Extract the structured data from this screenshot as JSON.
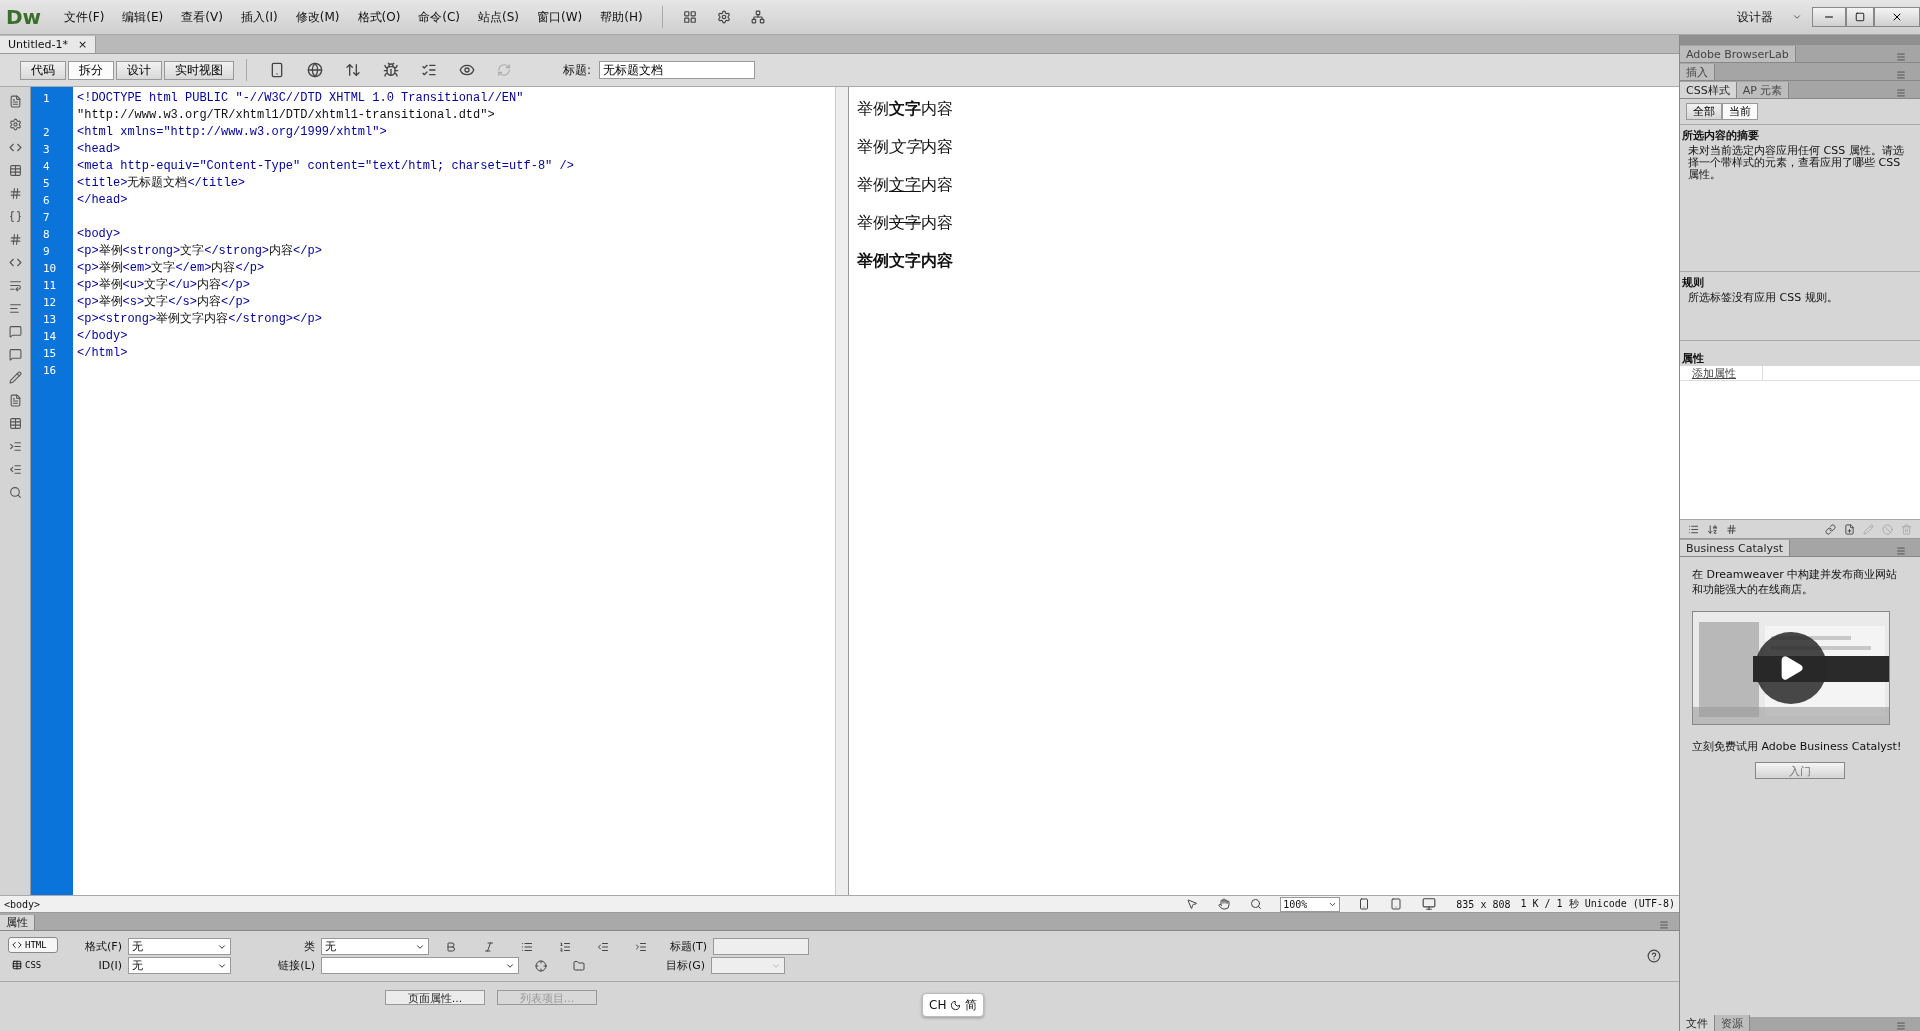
{
  "menu_bar": {
    "logo": "Dw",
    "items": [
      "文件(F)",
      "编辑(E)",
      "查看(V)",
      "插入(I)",
      "修改(M)",
      "格式(O)",
      "命令(C)",
      "站点(S)",
      "窗口(W)",
      "帮助(H)"
    ],
    "workspace": "设计器"
  },
  "document_tab": {
    "title": "Untitled-1*",
    "close": "×"
  },
  "view_buttons": [
    {
      "label": "代码",
      "selected": false
    },
    {
      "label": "拆分",
      "selected": true
    },
    {
      "label": "设计",
      "selected": false
    },
    {
      "label": "实时视图",
      "selected": false
    }
  ],
  "title_field": {
    "label": "标题:",
    "value": "无标题文档"
  },
  "code_lines": [
    {
      "number": "1",
      "text": "<!DOCTYPE html PUBLIC \"-//W3C//DTD XHTML 1.0 Transitional//EN\"",
      "wrap": "\"http://www.w3.org/TR/xhtml1/DTD/xhtml1-transitional.dtd\">"
    },
    {
      "number": "2",
      "text": "<html xmlns=\"http://www.w3.org/1999/xhtml\">"
    },
    {
      "number": "3",
      "text": "<head>"
    },
    {
      "number": "4",
      "text": "<meta http-equiv=\"Content-Type\" content=\"text/html; charset=utf-8\" />"
    },
    {
      "number": "5",
      "text": "<title>无标题文档</title>"
    },
    {
      "number": "6",
      "text": "</head>"
    },
    {
      "number": "7"
    },
    {
      "number": "8",
      "text": "<body>"
    },
    {
      "number": "9",
      "text": "<p>举例<strong>文字</strong>内容</p>"
    },
    {
      "number": "10",
      "text": "<p>举例<em>文字</em>内容</p>"
    },
    {
      "number": "11",
      "text": "<p>举例<u>文字</u>内容</p>"
    },
    {
      "number": "12",
      "text": "<p>举例<s>文字</s>内容</p>"
    },
    {
      "number": "13",
      "text": "<p><strong>举例文字内容</strong></p>"
    },
    {
      "number": "14",
      "text": "</body>"
    },
    {
      "number": "15",
      "text": "</html>"
    },
    {
      "number": "16"
    }
  ],
  "design_paragraphs": [
    {
      "kind": "bold",
      "parts": [
        "举例",
        "文字",
        "内容"
      ]
    },
    {
      "kind": "italic",
      "parts": [
        "举例",
        "文字",
        "内容"
      ]
    },
    {
      "kind": "underline",
      "parts": [
        "举例",
        "文字",
        "内容"
      ]
    },
    {
      "kind": "strike",
      "parts": [
        "举例",
        "文字",
        "内容"
      ]
    },
    {
      "kind": "bold",
      "parts": [
        "举例文字内容"
      ]
    }
  ],
  "tag_selector": "<body>",
  "design_status": {
    "zoom": "100%",
    "size": "835 x 808",
    "info": "1 K / 1 秒 Unicode (UTF-8)"
  },
  "properties": {
    "tab": "属性",
    "modes": [
      {
        "label": "HTML",
        "selected": true
      },
      {
        "label": "CSS",
        "selected": false
      }
    ],
    "format": {
      "label": "格式(F)",
      "value": "无"
    },
    "id": {
      "label": "ID(I)",
      "value": "无"
    },
    "class": {
      "label": "类",
      "value": "无"
    },
    "link": {
      "label": "链接(L)"
    },
    "title": {
      "label": "标题(T)"
    },
    "target": {
      "label": "目标(G)"
    },
    "buttons": [
      {
        "label": "页面属性...",
        "disabled": false
      },
      {
        "label": "列表项目...",
        "disabled": true
      }
    ]
  },
  "right_panel": {
    "browserlab": "Adobe BrowserLab",
    "insert": "插入",
    "css_tabs": [
      {
        "label": "CSS样式",
        "selected": true
      },
      {
        "label": "AP 元素",
        "selected": false
      }
    ],
    "css_modes": [
      {
        "label": "全部",
        "selected": false
      },
      {
        "label": "当前",
        "selected": true
      }
    ],
    "summary": {
      "heading": "所选内容的摘要",
      "text": "未对当前选定内容应用任何 CSS 属性。请选择一个带样式的元素，查看应用了哪些 CSS 属性。"
    },
    "rules": {
      "heading": "规则",
      "text": "所选标签没有应用 CSS 规则。"
    },
    "attributes": {
      "heading": "属性",
      "add_link": "添加属性"
    },
    "business_catalyst": {
      "tab": "Business Catalyst",
      "intro": "在 Dreamweaver 中构建并发布商业网站和功能强大的在线商店。",
      "promo": "立刻免费试用 Adobe Business Catalyst!",
      "button": "入门"
    },
    "bottom_tabs": [
      {
        "label": "文件",
        "selected": true
      },
      {
        "label": "资源",
        "selected": false
      }
    ]
  },
  "ime": {
    "mode": "CH",
    "script": "简"
  }
}
